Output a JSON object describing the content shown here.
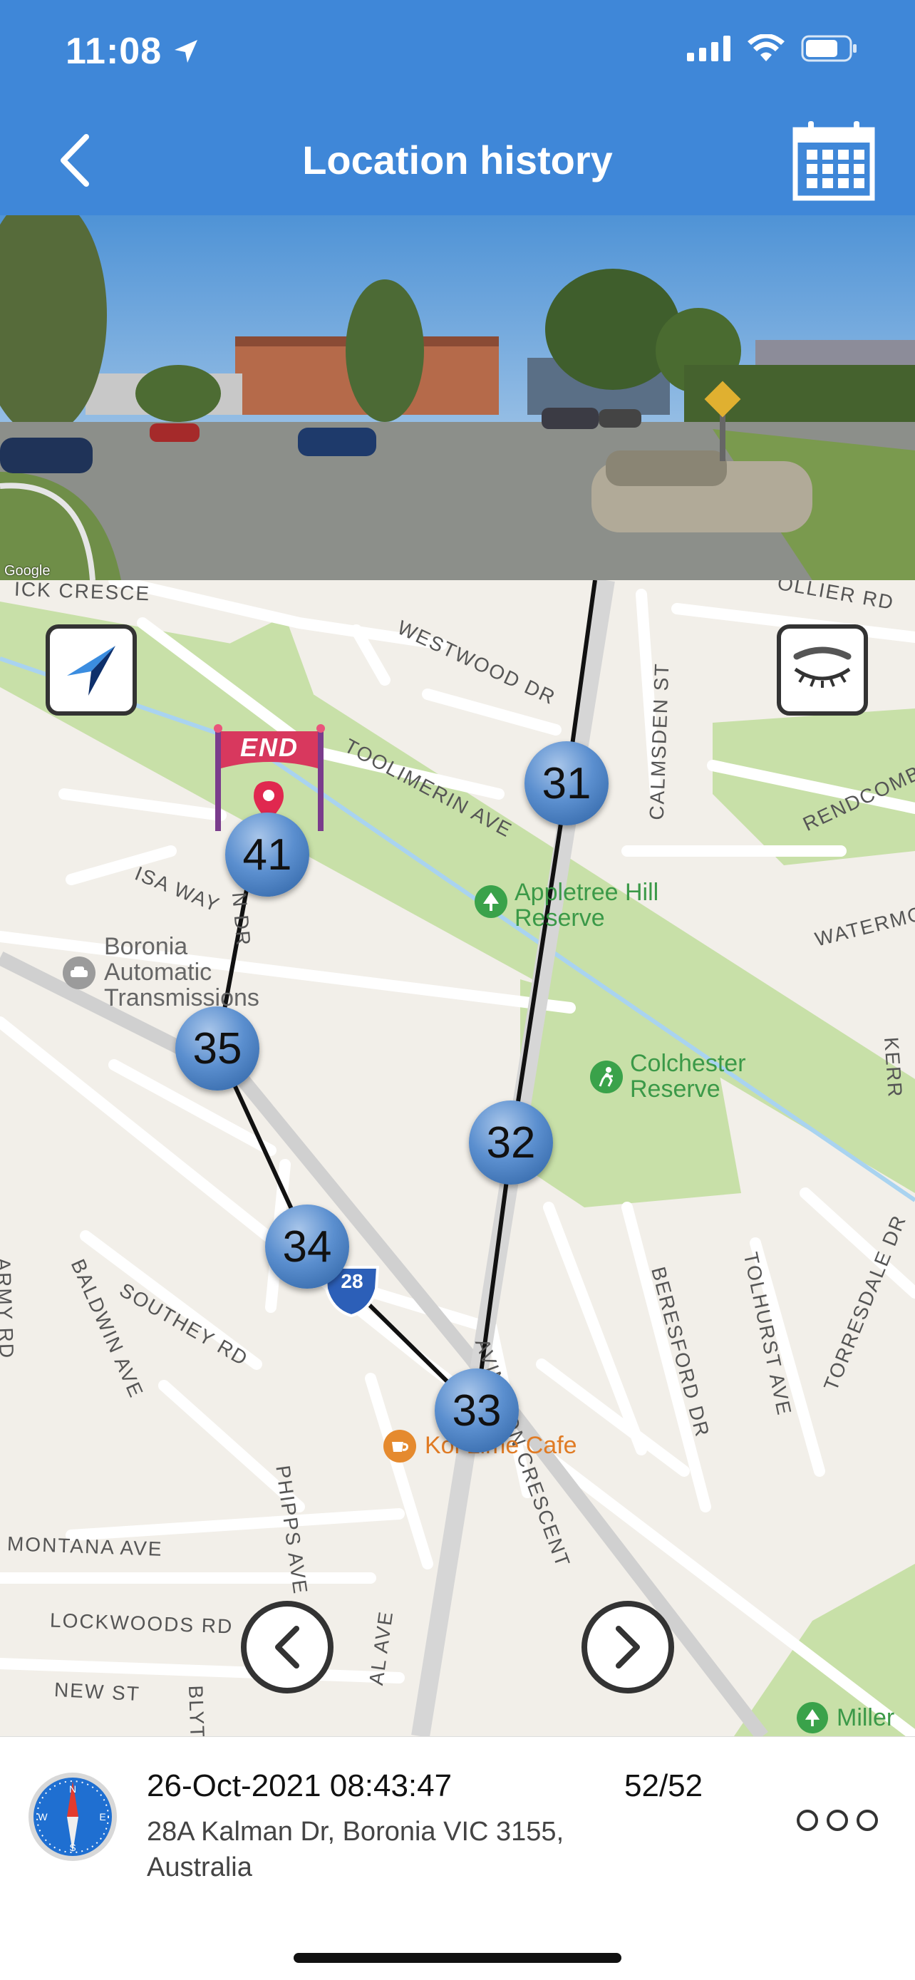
{
  "status_bar": {
    "time": "11:08"
  },
  "header": {
    "title": "Location history",
    "back_icon": "chevron-left-icon",
    "calendar_icon": "calendar-icon"
  },
  "street_view": {
    "attribution": "Google"
  },
  "map": {
    "streets": {
      "westwood": "WESTWOOD DR",
      "toolimerin": "TOOLIMERIN AVE",
      "calmsden": "CALMSDEN ST",
      "rendcomb": "RENDCOMB ST",
      "watermo": "WATERMO",
      "isa": "ISA WAY",
      "n_dr": "N DR",
      "avington": "AVINGTON CRESCENT",
      "beresford": "BERESFORD DR",
      "tolhurst": "TOLHURST AVE",
      "torresdale": "TORRESDALE DR",
      "baldwin": "BALDWIN AVE",
      "southey": "SOUTHEY RD",
      "phipps": "PHIPPS AVE",
      "montana": "MONTANA AVE",
      "lockwoods": "LOCKWOODS RD",
      "new_st": "NEW ST",
      "blyth": "BLYT",
      "crescent_top": "ICK CRESCE",
      "ollier": "OLLIER RD",
      "kerr": "KERR",
      "army": "ARMY RD",
      "al_ave": "AL AVE"
    },
    "pois": {
      "appletree": "Appletree Hill Reserve",
      "boronia": "Boronia Automatic Transmissions",
      "colchester": "Colchester Reserve",
      "cafe": "Koi Lime Cafe",
      "miller": "Miller"
    },
    "route_shield": "28",
    "end_label": "END",
    "markers": [
      "31",
      "32",
      "33",
      "34",
      "35",
      "41"
    ],
    "buttons": {
      "locate_icon": "navigation-arrow-icon",
      "visibility_icon": "eye-closed-icon",
      "prev_icon": "chevron-left-icon",
      "next_icon": "chevron-right-icon"
    }
  },
  "panel": {
    "datetime": "26-Oct-2021 08:43:47",
    "position": "52/52",
    "address": "28A Kalman Dr, Boronia VIC 3155, Australia",
    "compass_icon": "compass-icon",
    "more_icon": "more-dots-icon"
  }
}
